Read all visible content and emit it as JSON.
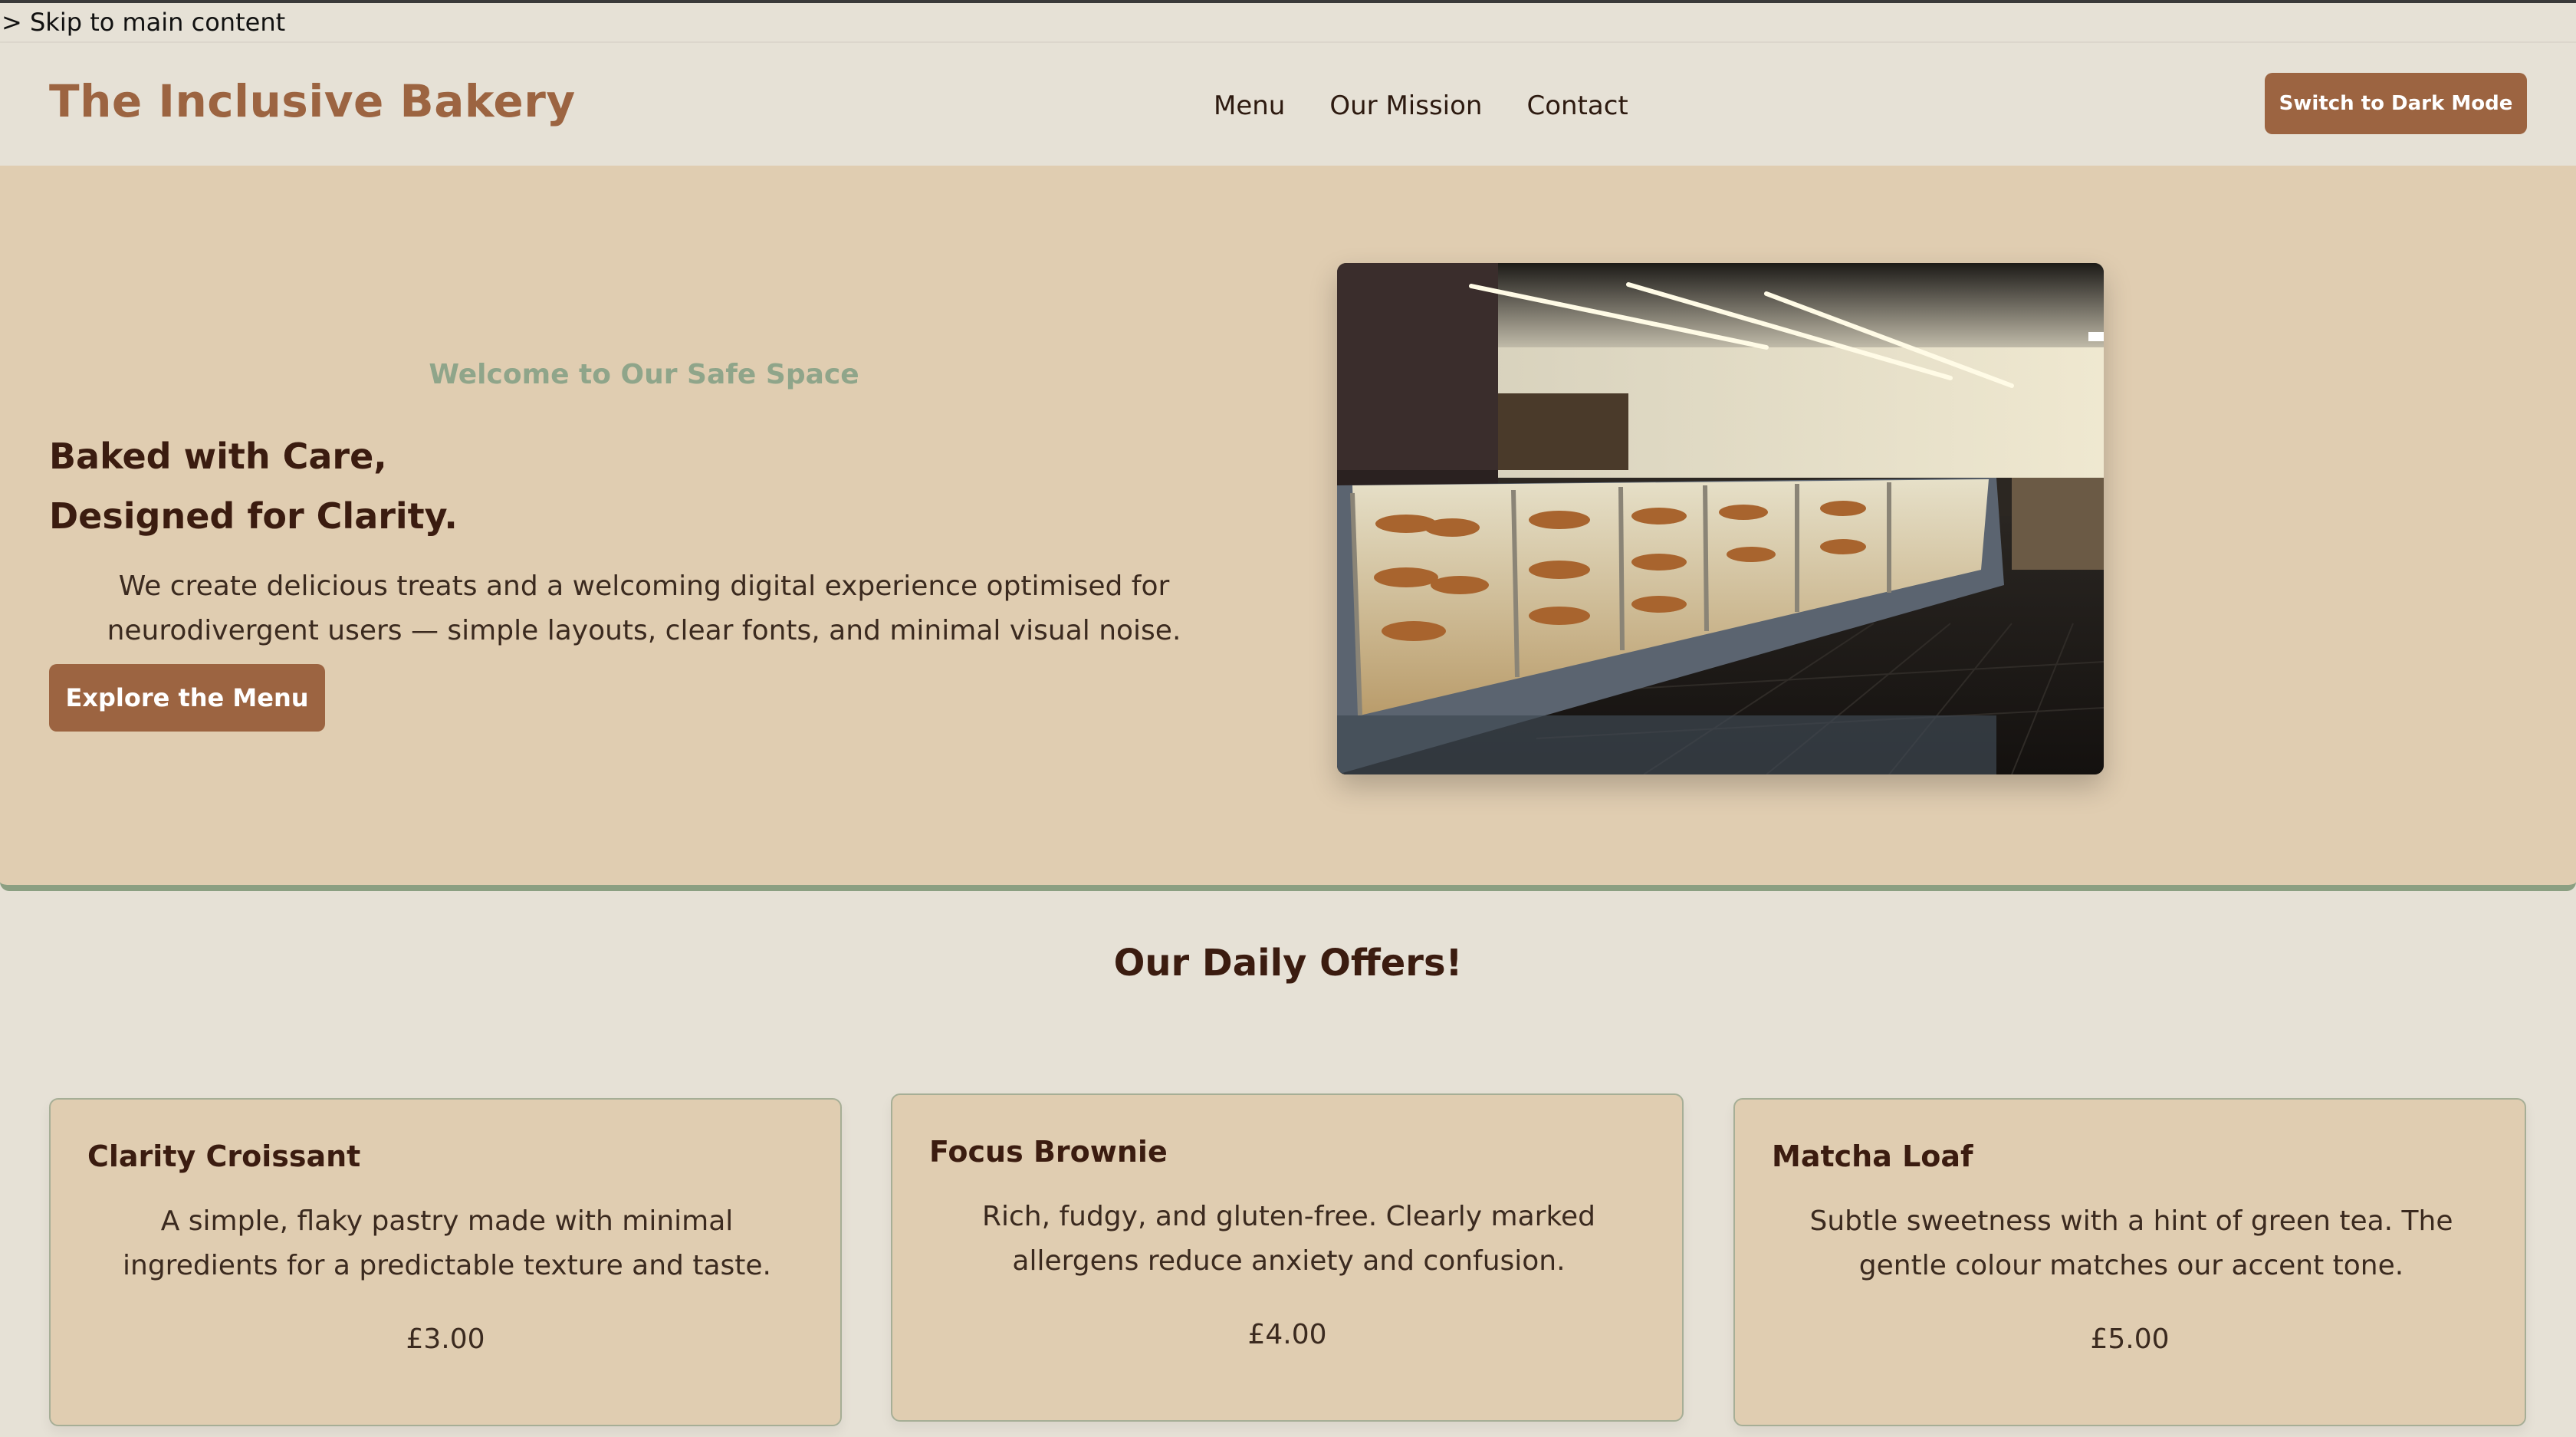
{
  "skip_link": "> Skip to main content",
  "header": {
    "logo": "The Inclusive Bakery",
    "nav": [
      "Menu",
      "Our Mission",
      "Contact"
    ],
    "dark_mode_button": "Switch to Dark Mode"
  },
  "hero": {
    "kicker": "Welcome to Our Safe Space",
    "title_line1": "Baked with Care,",
    "title_line2": "Designed for Clarity.",
    "text": "We create delicious treats and a welcoming digital experience optimised for neurodivergent users — simple layouts, clear fonts, and minimal visual noise.",
    "cta": "Explore the Menu",
    "image_icon": "bakery-display-photo"
  },
  "offers": {
    "title": "Our Daily Offers!",
    "items": [
      {
        "name": "Clarity Croissant",
        "description": "A simple, flaky pastry made with minimal ingredients for a predictable texture and taste.",
        "price": "£3.00"
      },
      {
        "name": "Focus Brownie",
        "description": "Rich, fudgy, and gluten-free. Clearly marked allergens reduce anxiety and confusion.",
        "price": "£4.00"
      },
      {
        "name": "Matcha Loaf",
        "description": "Subtle sweetness with a hint of green tea. The gentle colour matches our accent tone.",
        "price": "£5.00"
      }
    ]
  },
  "colors": {
    "accent": "#9c6441",
    "sage": "#8fa58a",
    "hero_bg": "#e0cdb1",
    "page_bg": "#e6e1d6",
    "text_dark": "#3b1c10"
  }
}
